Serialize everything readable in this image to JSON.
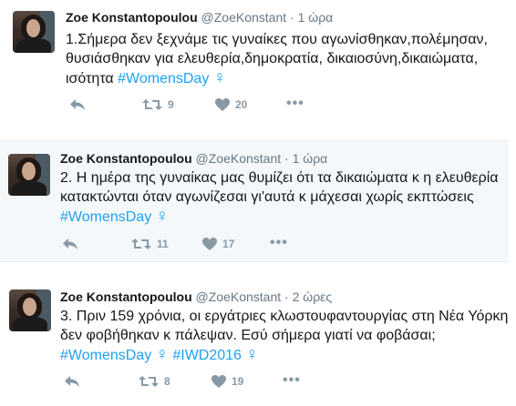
{
  "tweets": [
    {
      "author": "Zoe Konstantopoulou",
      "handle": "@ZoeKonstant",
      "separator": "·",
      "time": "1 ώρα",
      "lines": [
        "1.Σήμερα δεν ξεχνάμε τις γυναίκες που αγωνίσθηκαν,πολέμησαν,",
        "θυσιάσθηκαν για ελευθερία,δημοκρατία, δικαιοσύνη,δικαιώματα,",
        "ισότητα"
      ],
      "hashtags": [
        "#WomensDay"
      ],
      "symbol": "♀",
      "retweets": "9",
      "likes": "20"
    },
    {
      "author": "Zoe Konstantopoulou",
      "handle": "@ZoeKonstant",
      "separator": "·",
      "time": "1 ώρα",
      "lines": [
        "2. Η ημέρα της γυναίκας μας θυμίζει ότι τα δικαιώματα κ η ελευθερία",
        "κατακτώνται όταν αγωνίζεσαι γι'αυτά κ μάχεσαι χωρίς εκπτώσεις"
      ],
      "hashtags": [
        "#WomensDay"
      ],
      "symbol": "♀",
      "retweets": "11",
      "likes": "17"
    },
    {
      "author": "Zoe Konstantopoulou",
      "handle": "@ZoeKonstant",
      "separator": "·",
      "time": "2 ώρες",
      "lines": [
        "3. Πριν 159 χρόνια, οι εργάτριες κλωστουφαντουργίας στη Νέα Υόρκη",
        "δεν φοβήθηκαν κ πάλεψαν. Εσύ σήμερα γιατί να φοβάσαι;"
      ],
      "hashtags": [
        "#WomensDay",
        "#IWD2016"
      ],
      "symbol": "♀",
      "retweets": "8",
      "likes": "19"
    }
  ],
  "icons": {
    "reply": "reply-icon",
    "retweet": "retweet-icon",
    "like": "heart-icon",
    "more": "more-icon"
  },
  "colors": {
    "hashtag": "#1da1f2",
    "muted": "#8899a6",
    "text": "#14171a",
    "highlight_bg": "#f5f8fa"
  }
}
